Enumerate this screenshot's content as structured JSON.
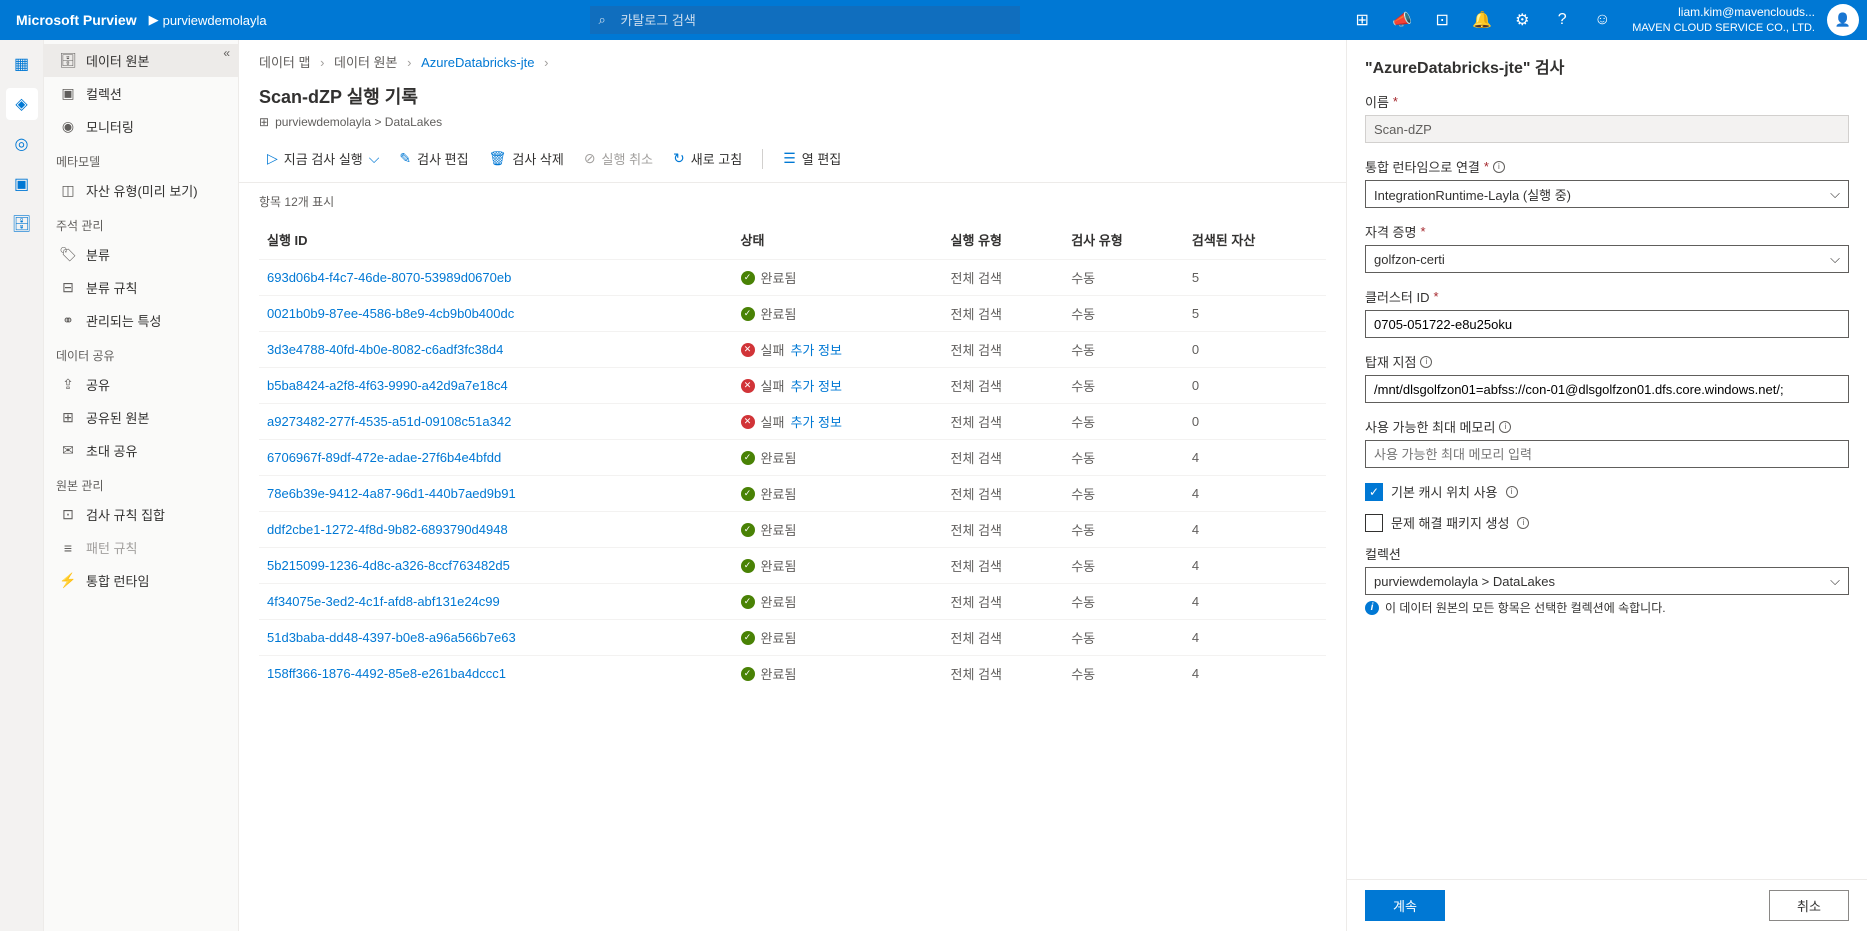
{
  "header": {
    "product": "Microsoft Purview",
    "workspace": "purviewdemolayla",
    "search_placeholder": "카탈로그 검색",
    "user_email": "liam.kim@mavenclouds...",
    "user_company": "MAVEN CLOUD SERVICE CO., LTD."
  },
  "sidebar": {
    "items": [
      {
        "label": "데이터 원본",
        "selected": true
      },
      {
        "label": "컬렉션"
      },
      {
        "label": "모니터링"
      }
    ],
    "section_meta": "메타모델",
    "meta_items": [
      {
        "label": "자산 유형(미리 보기)"
      }
    ],
    "section_annotate": "주석 관리",
    "annotate_items": [
      {
        "label": "분류"
      },
      {
        "label": "분류 규칙"
      },
      {
        "label": "관리되는 특성"
      }
    ],
    "section_share": "데이터 공유",
    "share_items": [
      {
        "label": "공유"
      },
      {
        "label": "공유된 원본"
      },
      {
        "label": "초대 공유"
      }
    ],
    "section_source": "원본 관리",
    "source_items": [
      {
        "label": "검사 규칙 집합"
      },
      {
        "label": "패턴 규칙",
        "muted": true
      },
      {
        "label": "통합 런타임"
      }
    ]
  },
  "breadcrumb": {
    "p1": "데이터 맵",
    "p2": "데이터 원본",
    "p3": "AzureDatabricks-jte"
  },
  "page": {
    "title": "Scan-dZP 실행 기록",
    "sub_path": "purviewdemolayla > DataLakes",
    "count_text": "항목 12개 표시"
  },
  "toolbar": {
    "run": "지금 검사 실행",
    "edit": "검사 편집",
    "delete": "검사 삭제",
    "cancel": "실행 취소",
    "refresh": "새로 고침",
    "columns": "열 편집"
  },
  "table": {
    "headers": {
      "id": "실행 ID",
      "status": "상태",
      "runtype": "실행 유형",
      "scantype": "검사 유형",
      "assets": "검색된 자산"
    },
    "status_complete": "완료됨",
    "status_fail": "실패",
    "status_more": "추가 정보",
    "cell_fullscan": "전체 검색",
    "cell_manual": "수동",
    "rows": [
      {
        "id": "693d06b4-f4c7-46de-8070-53989d0670eb",
        "ok": true,
        "assets": "5"
      },
      {
        "id": "0021b0b9-87ee-4586-b8e9-4cb9b0b400dc",
        "ok": true,
        "assets": "5"
      },
      {
        "id": "3d3e4788-40fd-4b0e-8082-c6adf3fc38d4",
        "ok": false,
        "assets": "0"
      },
      {
        "id": "b5ba8424-a2f8-4f63-9990-a42d9a7e18c4",
        "ok": false,
        "assets": "0"
      },
      {
        "id": "a9273482-277f-4535-a51d-09108c51a342",
        "ok": false,
        "assets": "0"
      },
      {
        "id": "6706967f-89df-472e-adae-27f6b4e4bfdd",
        "ok": true,
        "assets": "4"
      },
      {
        "id": "78e6b39e-9412-4a87-96d1-440b7aed9b91",
        "ok": true,
        "assets": "4"
      },
      {
        "id": "ddf2cbe1-1272-4f8d-9b82-6893790d4948",
        "ok": true,
        "assets": "4"
      },
      {
        "id": "5b215099-1236-4d8c-a326-8ccf763482d5",
        "ok": true,
        "assets": "4"
      },
      {
        "id": "4f34075e-3ed2-4c1f-afd8-abf131e24c99",
        "ok": true,
        "assets": "4"
      },
      {
        "id": "51d3baba-dd48-4397-b0e8-a96a566b7e63",
        "ok": true,
        "assets": "4"
      },
      {
        "id": "158ff366-1876-4492-85e8-e261ba4dccc1",
        "ok": true,
        "assets": "4"
      }
    ]
  },
  "panel": {
    "title": "\"AzureDatabricks-jte\" 검사",
    "name_label": "이름",
    "name_value": "Scan-dZP",
    "runtime_label": "통합 런타임으로 연결",
    "runtime_value": "IntegrationRuntime-Layla (실행 중)",
    "cred_label": "자격 증명",
    "cred_value": "golfzon-certi",
    "cluster_label": "클러스터 ID",
    "cluster_value": "0705-051722-e8u25oku",
    "mount_label": "탑재 지점",
    "mount_value": "/mnt/dlsgolfzon01=abfss://con-01@dlsgolfzon01.dfs.core.windows.net/;",
    "memory_label": "사용 가능한 최대 메모리",
    "memory_placeholder": "사용 가능한 최대 메모리 입력",
    "cache_label": "기본 캐시 위치 사용",
    "troubleshoot_label": "문제 해결 패키지 생성",
    "collection_label": "컬렉션",
    "collection_value": "purviewdemolayla > DataLakes",
    "info_text": "이 데이터 원본의 모든 항목은 선택한 컬렉션에 속합니다.",
    "btn_continue": "계속",
    "btn_cancel": "취소"
  }
}
